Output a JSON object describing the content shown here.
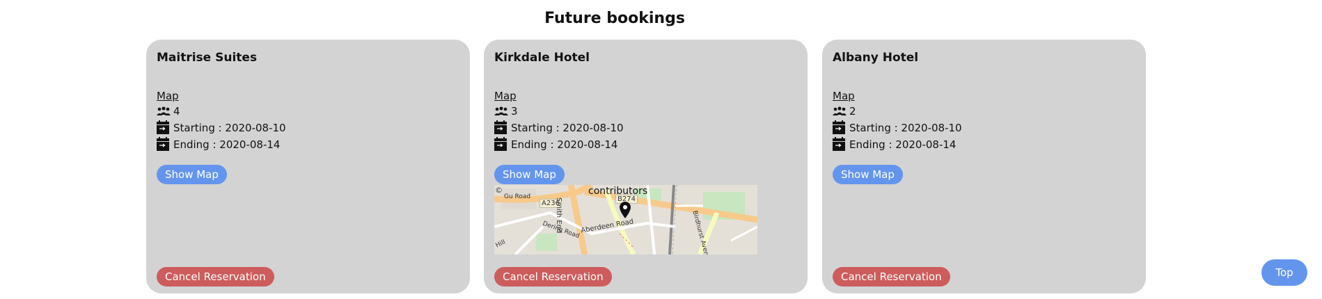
{
  "page": {
    "title": "Future bookings"
  },
  "bookings": [
    {
      "hotel": "Maitrise Suites",
      "map_link": "Map",
      "guests": "4",
      "starting": "Starting : 2020-08-10",
      "ending": "Ending : 2020-08-14",
      "show_map_label": "Show Map",
      "cancel_label": "Cancel Reservation"
    },
    {
      "hotel": "Kirkdale Hotel",
      "map_link": "Map",
      "guests": "3",
      "starting": "Starting : 2020-08-10",
      "ending": "Ending : 2020-08-14",
      "show_map_label": "Show Map",
      "cancel_label": "Cancel Reservation",
      "map": {
        "attribution": "contributors",
        "copyright": "©",
        "roads": [
          "A236",
          "B274",
          "Aberdeen Road",
          "Smith End",
          "Dering Road",
          "Birdhurst Avenue",
          "Gu Road",
          "Hill"
        ]
      }
    },
    {
      "hotel": "Albany Hotel",
      "map_link": "Map",
      "guests": "2",
      "starting": "Starting : 2020-08-10",
      "ending": "Ending : 2020-08-14",
      "show_map_label": "Show Map",
      "cancel_label": "Cancel Reservation"
    }
  ],
  "top_button_label": "Top",
  "colors": {
    "card_bg": "#d3d3d3",
    "show_map_button": "#6495ed",
    "cancel_button": "#cd5c5c",
    "top_button": "#6495ed"
  },
  "icons": {
    "guests": "group-people-icon",
    "starting": "calendar-check-in-icon",
    "ending": "calendar-check-out-icon",
    "map_marker": "map-marker-icon"
  }
}
